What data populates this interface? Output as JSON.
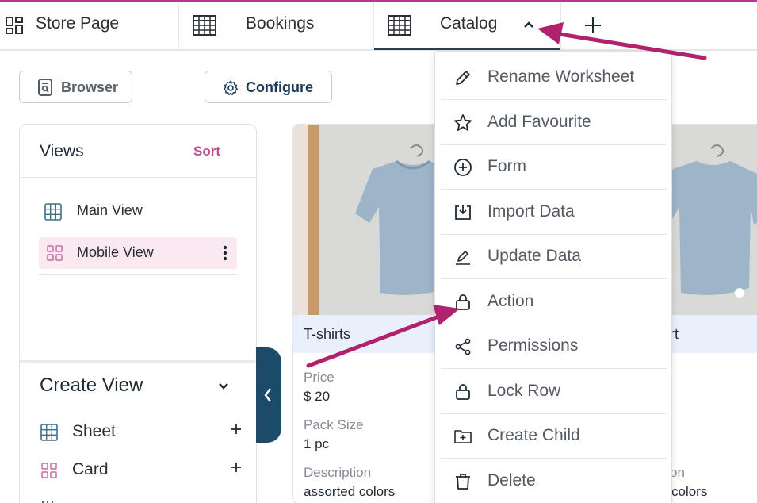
{
  "tabs": [
    {
      "label": "Store Page",
      "icon": "dashboard-icon"
    },
    {
      "label": "Bookings",
      "icon": "table-icon"
    },
    {
      "label": "Catalog",
      "icon": "table-icon",
      "active": true,
      "menu_open": true
    }
  ],
  "toolbar": {
    "browser_label": "Browser",
    "configure_label": "Configure"
  },
  "views": {
    "title": "Views",
    "sort_label": "Sort",
    "items": [
      {
        "label": "Main View",
        "icon": "grid-table-icon"
      },
      {
        "label": "Mobile View",
        "icon": "card-grid-icon",
        "selected": true
      }
    ]
  },
  "create_view": {
    "title": "Create View",
    "items": [
      {
        "label": "Sheet",
        "icon": "grid-table-icon"
      },
      {
        "label": "Card",
        "icon": "card-grid-icon"
      }
    ]
  },
  "cards": [
    {
      "name": "T-shirts",
      "fields": [
        {
          "label": "Price",
          "value": "$ 20"
        },
        {
          "label": "Pack Size",
          "value": "1 pc"
        },
        {
          "label": "Description",
          "value": "assorted colors"
        }
      ]
    },
    {
      "name": "rt",
      "fields": [
        {
          "label": "on",
          "value": "colors"
        }
      ]
    }
  ],
  "menu": {
    "items": [
      {
        "label": "Rename Worksheet",
        "icon": "pencil-icon"
      },
      {
        "label": "Add Favourite",
        "icon": "star-icon"
      },
      {
        "label": "Form",
        "icon": "plus-circle-icon"
      },
      {
        "label": "Import Data",
        "icon": "import-icon"
      },
      {
        "label": "Update Data",
        "icon": "edit-line-icon"
      },
      {
        "label": "Action",
        "icon": "lock-icon"
      },
      {
        "label": "Permissions",
        "icon": "share-icon"
      },
      {
        "label": "Lock Row",
        "icon": "lock-icon"
      },
      {
        "label": "Create Child",
        "icon": "folder-plus-icon"
      },
      {
        "label": "Delete",
        "icon": "trash-icon"
      }
    ]
  },
  "colors": {
    "accent": "#c0508e",
    "annotation_arrow": "#b0226e",
    "sidebar_handle": "#1b4b68",
    "selected_row_bg": "#fbe9f2",
    "card_name_bar": "#e9f0fb"
  }
}
